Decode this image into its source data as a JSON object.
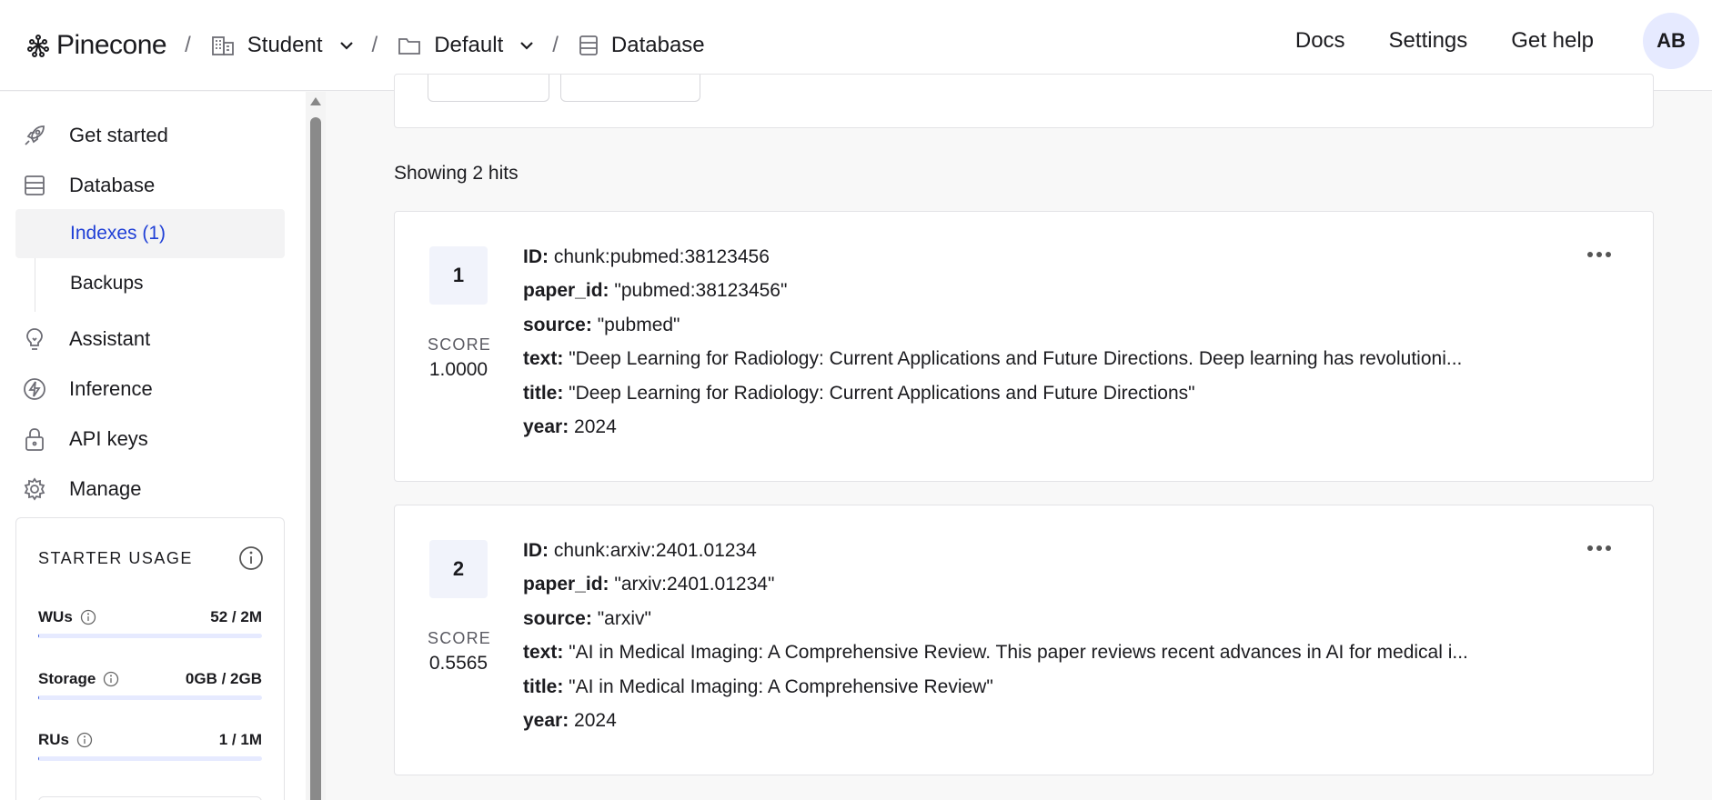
{
  "header": {
    "logo_text": "Pinecone",
    "breadcrumbs": [
      {
        "label": "Student",
        "icon": "building-icon",
        "has_dropdown": true
      },
      {
        "label": "Default",
        "icon": "folder-icon",
        "has_dropdown": true
      },
      {
        "label": "Database",
        "icon": "database-icon",
        "has_dropdown": false
      }
    ],
    "separator": "/",
    "links": {
      "docs": "Docs",
      "settings": "Settings",
      "help": "Get help"
    },
    "avatar_initials": "AB"
  },
  "sidebar": {
    "items": {
      "get_started": "Get started",
      "database": "Database",
      "indexes": "Indexes (1)",
      "backups": "Backups",
      "assistant": "Assistant",
      "inference": "Inference",
      "api_keys": "API keys",
      "manage": "Manage"
    },
    "usage": {
      "title": "STARTER USAGE",
      "rows": [
        {
          "label": "WUs",
          "value": "52 / 2M",
          "fraction": 3e-05
        },
        {
          "label": "Storage",
          "value": "0GB / 2GB",
          "fraction": 0.0
        },
        {
          "label": "RUs",
          "value": "1 / 1M",
          "fraction": 1e-06
        }
      ]
    }
  },
  "main": {
    "showing": "Showing 2 hits",
    "score_label": "SCORE",
    "hits": [
      {
        "rank": "1",
        "score": "1.0000",
        "fields": [
          {
            "key": "ID:",
            "value": "chunk:pubmed:38123456"
          },
          {
            "key": "paper_id:",
            "value": "\"pubmed:38123456\""
          },
          {
            "key": "source:",
            "value": "\"pubmed\""
          },
          {
            "key": "text:",
            "value": "\"Deep Learning for Radiology: Current Applications and Future Directions. Deep learning has revolutioni..."
          },
          {
            "key": "title:",
            "value": "\"Deep Learning for Radiology: Current Applications and Future Directions\""
          },
          {
            "key": "year:",
            "value": "2024"
          }
        ]
      },
      {
        "rank": "2",
        "score": "0.5565",
        "fields": [
          {
            "key": "ID:",
            "value": "chunk:arxiv:2401.01234"
          },
          {
            "key": "paper_id:",
            "value": "\"arxiv:2401.01234\""
          },
          {
            "key": "source:",
            "value": "\"arxiv\""
          },
          {
            "key": "text:",
            "value": "\"AI in Medical Imaging: A Comprehensive Review. This paper reviews recent advances in AI for medical i..."
          },
          {
            "key": "title:",
            "value": "\"AI in Medical Imaging: A Comprehensive Review\""
          },
          {
            "key": "year:",
            "value": "2024"
          }
        ]
      }
    ]
  }
}
